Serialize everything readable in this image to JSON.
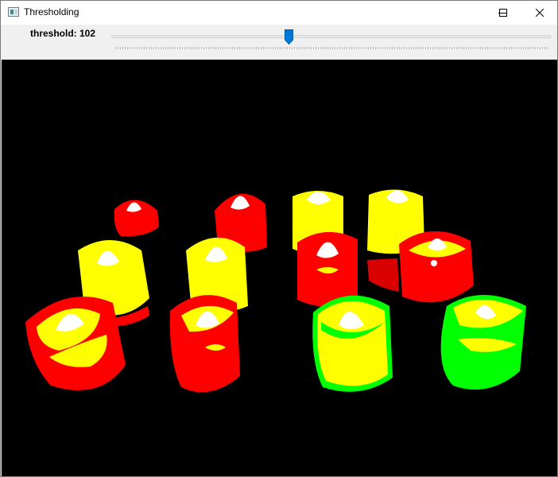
{
  "window": {
    "title": "Thresholding"
  },
  "trackbar": {
    "name": "threshold",
    "value": 102,
    "label": "threshold: 102",
    "min": 0,
    "max": 255
  },
  "colors": {
    "red": "#ff0000",
    "yellow": "#ffff00",
    "green": "#00ff00",
    "white": "#ffffff",
    "background": "#000000",
    "accent": "#0078d7"
  },
  "icons": {
    "minimize": "minimize-icon",
    "maximize": "maximize-icon",
    "close": "close-icon",
    "app": "app-icon"
  }
}
